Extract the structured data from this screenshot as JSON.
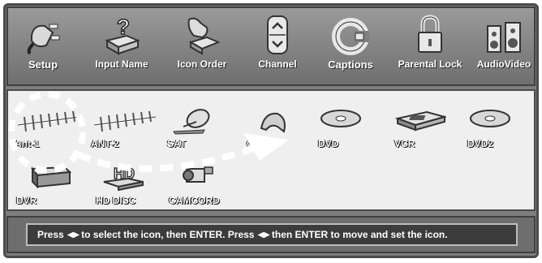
{
  "menu": {
    "items": [
      {
        "label": "Setup",
        "icon": "plug-icon"
      },
      {
        "label": "Input Name",
        "icon": "question-box-icon"
      },
      {
        "label": "Icon Order",
        "icon": "hand-pointer-icon"
      },
      {
        "label": "Channel",
        "icon": "channel-updown-icon"
      },
      {
        "label": "Captions",
        "icon": "captions-c-icon"
      },
      {
        "label": "Parental Lock",
        "icon": "padlock-icon"
      },
      {
        "label": "AudioVideo",
        "icon": "speakers-icon"
      }
    ]
  },
  "inputs": {
    "row1": [
      {
        "label": "Ant-1",
        "icon": "antenna-icon"
      },
      {
        "label": "ANT-2",
        "icon": "antenna-icon"
      },
      {
        "label": "SAT",
        "icon": "satellite-dish-icon"
      },
      {
        "label": "GAME",
        "icon": "game-controller-icon"
      },
      {
        "label": "DVD",
        "icon": "disc-icon"
      },
      {
        "label": "VCR",
        "icon": "vcr-icon"
      },
      {
        "label": "DVD2",
        "icon": "disc-icon"
      }
    ],
    "row2": [
      {
        "label": "DVR",
        "icon": "dvr-icon"
      },
      {
        "label": "HD DISC",
        "icon": "hd-disc-icon"
      },
      {
        "label": "CAMCORD",
        "icon": "camcorder-icon"
      }
    ]
  },
  "status": {
    "text_1": "Press",
    "text_2": "to select the icon, then ENTER.  Press",
    "text_3": "then ENTER to move and set the icon."
  },
  "colors": {
    "menu_bg": "#8a8a8a",
    "icon_area_bg": "#efefef",
    "status_bg": "#3c3c3c"
  }
}
